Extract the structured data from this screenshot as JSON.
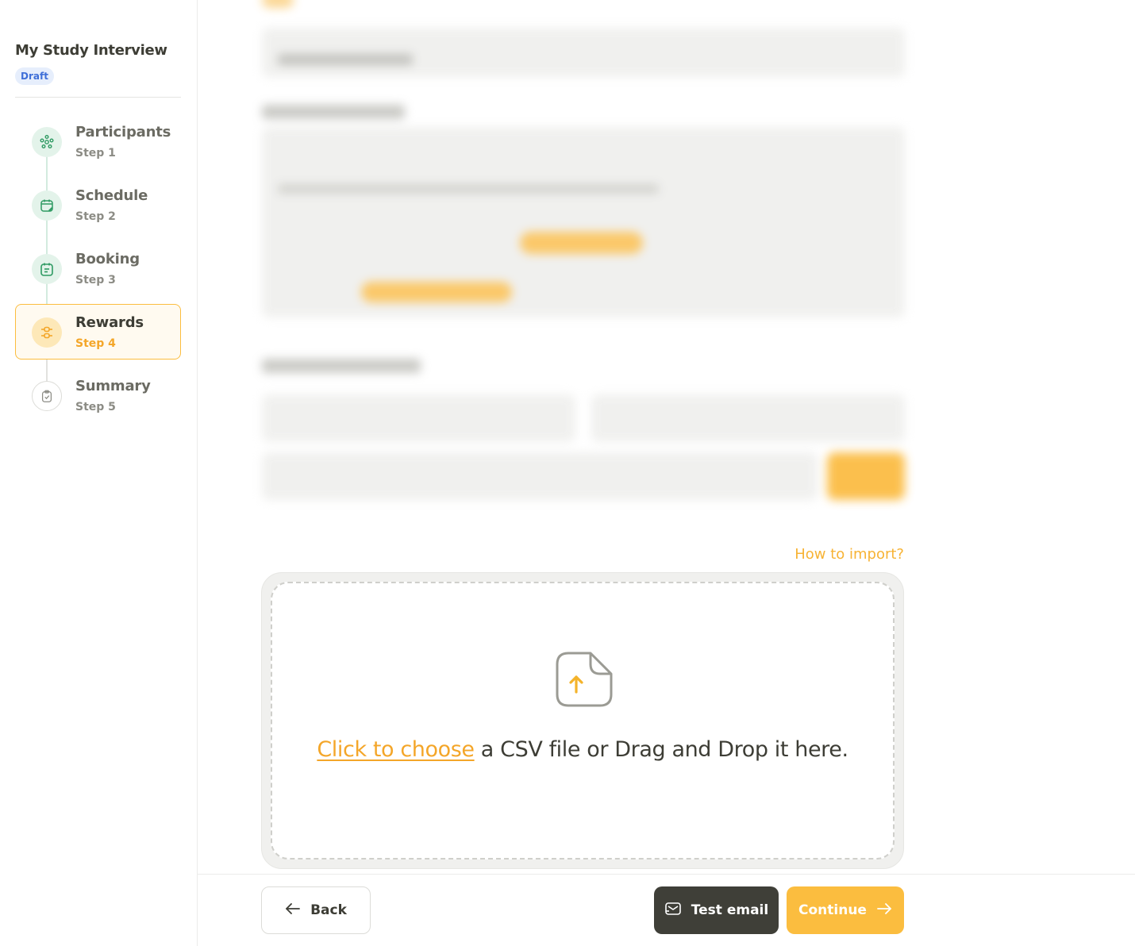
{
  "study": {
    "title": "My Study Interview",
    "status": "Draft"
  },
  "steps": [
    {
      "title": "Participants",
      "subtitle": "Step 1",
      "icon": "participants-icon",
      "state": "done"
    },
    {
      "title": "Schedule",
      "subtitle": "Step 2",
      "icon": "calendar-edit-icon",
      "state": "done"
    },
    {
      "title": "Booking",
      "subtitle": "Step 3",
      "icon": "calendar-list-icon",
      "state": "done"
    },
    {
      "title": "Rewards",
      "subtitle": "Step 4",
      "icon": "sliders-icon",
      "state": "active"
    },
    {
      "title": "Summary",
      "subtitle": "Step 5",
      "icon": "clipboard-check-icon",
      "state": "pending"
    }
  ],
  "import": {
    "help_link": "How to import?",
    "link_text": "Click to choose",
    "text_rest": " a CSV file or Drag and Drop it here."
  },
  "footer": {
    "back_label": "Back",
    "test_email_label": "Test email",
    "continue_label": "Continue"
  },
  "colors": {
    "accent": "#fbbd3f",
    "accent_text": "#f4a629",
    "done": "#2e9a62",
    "dark_button": "#3f3f38"
  }
}
